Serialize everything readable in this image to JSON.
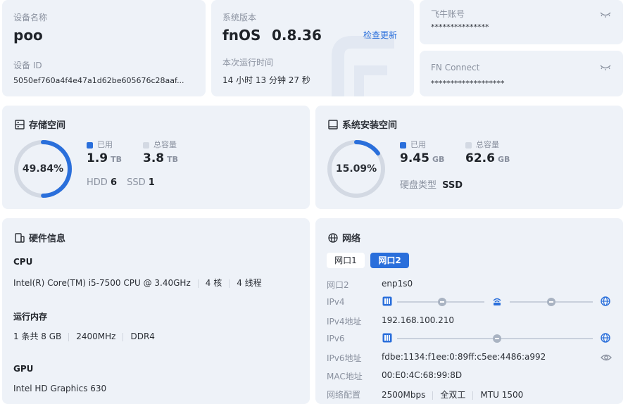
{
  "device": {
    "name_label": "设备名称",
    "name": "poo",
    "id_label": "设备 ID",
    "id": "5050ef760a4f4e47a1d62be605676c28aaf..."
  },
  "system": {
    "version_label": "系统版本",
    "os": "fnOS",
    "version": "0.8.36",
    "check_update": "检查更新",
    "uptime_label": "本次运行时间",
    "uptime": "14 小时 13 分钟 27 秒"
  },
  "feiniu": {
    "label": "飞牛账号",
    "value": "***************"
  },
  "fnconnect": {
    "label": "FN Connect",
    "value": "*******************"
  },
  "storage": {
    "title": "存储空间",
    "percent": "49.84%",
    "percent_value": 49.84,
    "used_label": "已用",
    "used": "1.9",
    "used_unit": "TB",
    "total_label": "总容量",
    "total": "3.8",
    "total_unit": "TB",
    "hdd_label": "HDD",
    "hdd": "6",
    "ssd_label": "SSD",
    "ssd": "1"
  },
  "sysstorage": {
    "title": "系统安装空间",
    "percent": "15.09%",
    "percent_value": 15.09,
    "used_label": "已用",
    "used": "9.45",
    "used_unit": "GB",
    "total_label": "总容量",
    "total": "62.6",
    "total_unit": "GB",
    "disk_type_label": "硬盘类型",
    "disk_type": "SSD"
  },
  "hardware": {
    "title": "硬件信息",
    "cpu_label": "CPU",
    "cpu_model": "Intel(R) Core(TM) i5-7500 CPU @ 3.40GHz",
    "cpu_cores": "4 核",
    "cpu_threads": "4 线程",
    "mem_label": "运行内存",
    "mem_count": "1 条共 8 GB",
    "mem_freq": "2400MHz",
    "mem_type": "DDR4",
    "gpu_label": "GPU",
    "gpu_model": "Intel HD Graphics 630"
  },
  "network": {
    "title": "网络",
    "tabs": [
      "网口1",
      "网口2"
    ],
    "active_tab": "网口2",
    "rows": [
      {
        "label": "网口2",
        "value": "enp1s0"
      },
      {
        "label": "IPv4",
        "value": ""
      },
      {
        "label": "IPv4地址",
        "value": "192.168.100.210"
      },
      {
        "label": "IPv6",
        "value": ""
      },
      {
        "label": "IPv6地址",
        "value": "fdbe:1134:f1ee:0:89ff:c5ee:4486:a992"
      },
      {
        "label": "MAC地址",
        "value": "00:E0:4C:68:99:8D"
      },
      {
        "label": "网络配置",
        "value": ""
      }
    ],
    "speed": "2500Mbps",
    "duplex": "全双工",
    "mtu": "MTU 1500"
  },
  "colors": {
    "accent": "#2a6fdb",
    "card_bg": "#eef2f8",
    "ring_track": "#d3d9e3",
    "muted": "#8a919f"
  }
}
